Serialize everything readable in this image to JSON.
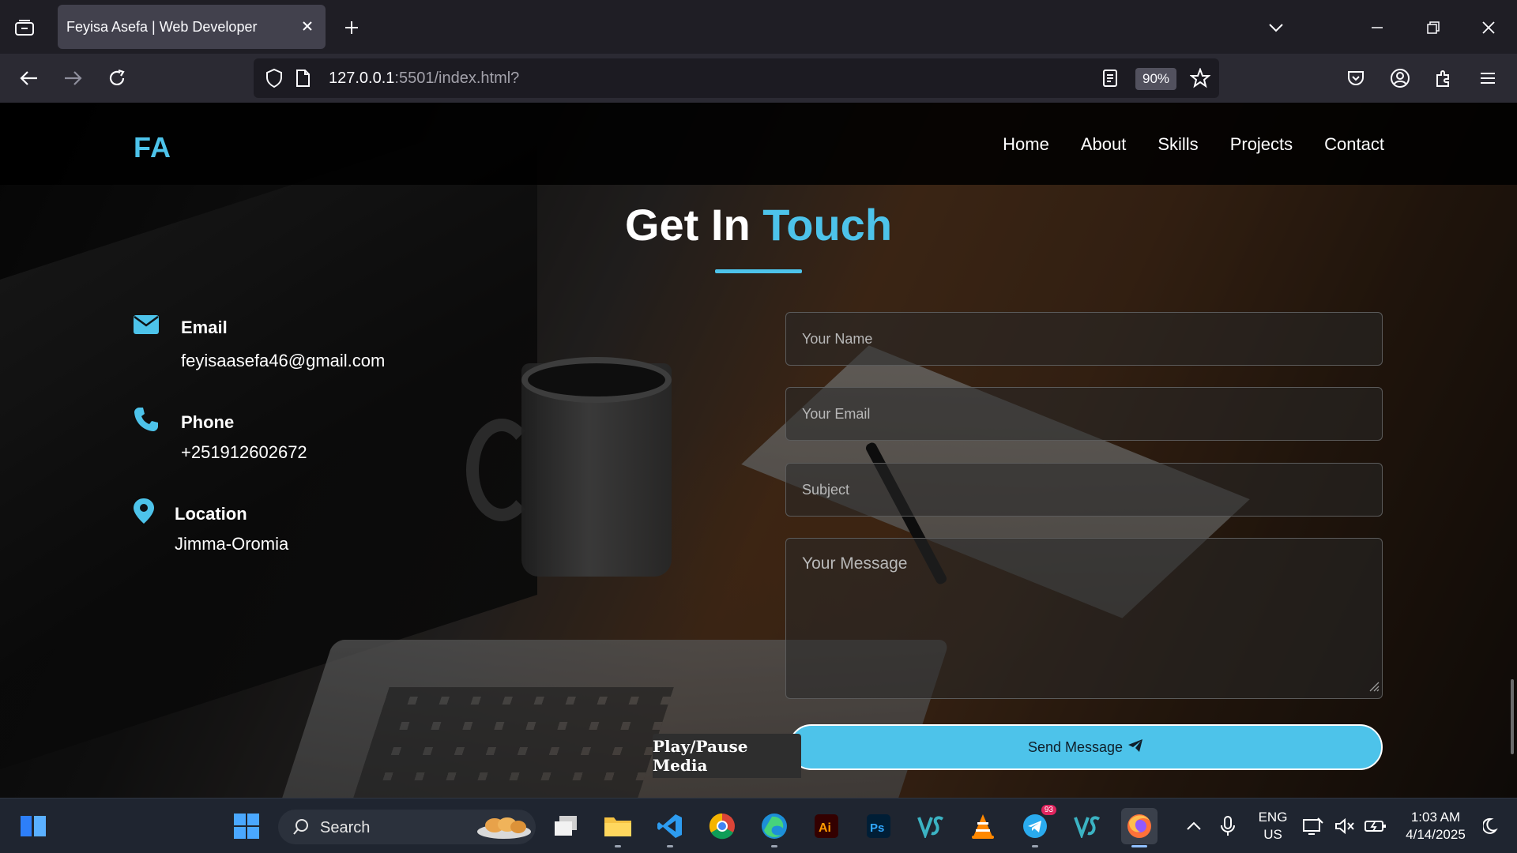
{
  "browser": {
    "tab_title": "Feyisa Asefa | Web Developer",
    "url_host": "127.0.0.1",
    "url_path": ":5501/index.html?",
    "zoom": "90%"
  },
  "site": {
    "logo": "FA",
    "nav": [
      "Home",
      "About",
      "Skills",
      "Projects",
      "Contact"
    ],
    "title_main": "Get In ",
    "title_accent": "Touch",
    "accent_color": "#4dc3ea",
    "contact": {
      "email_label": "Email",
      "email_value": "feyisaasefa46@gmail.com",
      "phone_label": "Phone",
      "phone_value": "+251912602672",
      "location_label": "Location",
      "location_value": "Jimma-Oromia"
    },
    "form": {
      "name_placeholder": "Your Name",
      "email_placeholder": "Your Email",
      "subject_placeholder": "Subject",
      "message_placeholder": "Your Message",
      "send_label": "Send Message"
    },
    "play_pause_label": "Play/Pause Media"
  },
  "taskbar": {
    "search_label": "Search",
    "telegram_badge": "93",
    "lang_line1": "ENG",
    "lang_line2": "US",
    "time": "1:03 AM",
    "date": "4/14/2025"
  }
}
